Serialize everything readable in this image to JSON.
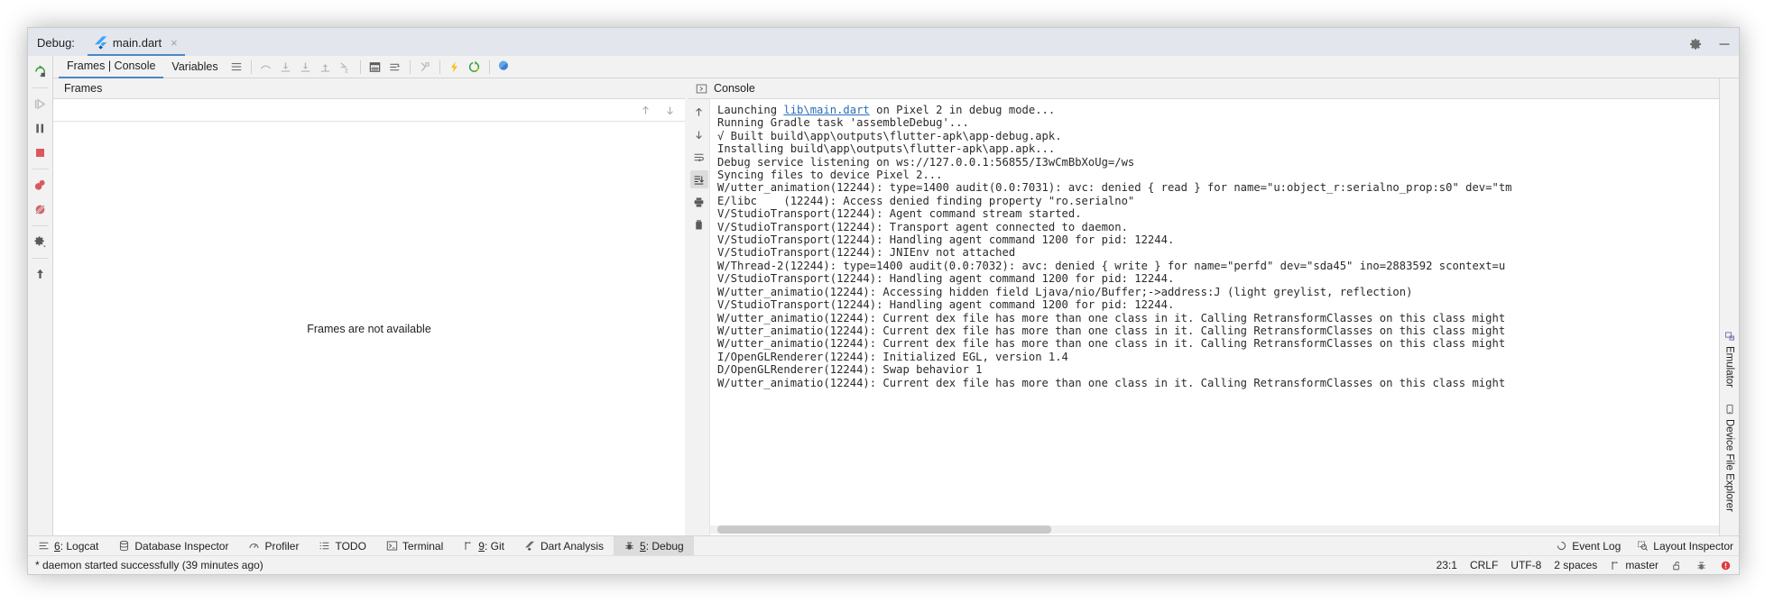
{
  "window": {
    "debug_label": "Debug:",
    "tab_title": "main.dart",
    "tab_close": "×",
    "settings_icon": "gear-icon",
    "minimize_icon": "minimize-icon"
  },
  "debug_toolbar": {
    "tabs": [
      {
        "label": "Frames | Console",
        "active": true
      },
      {
        "label": "Variables",
        "active": false
      }
    ],
    "icons": [
      "rerun-icon",
      "layout-icon",
      "step-over-icon",
      "step-into-icon",
      "force-step-into-icon",
      "step-out-icon",
      "run-to-cursor-icon",
      "evaluate-expression-icon",
      "watches-icon",
      "threads-icon",
      "hot-reload-icon",
      "hot-restart-icon",
      "open-devtools-icon"
    ],
    "layout_menu_icon": "layout-settings-icon"
  },
  "rail": {
    "buttons": [
      "rerun-icon",
      "resume-program-icon",
      "pause-program-icon",
      "stop-icon",
      "view-breakpoints-icon",
      "mute-breakpoints-icon",
      "settings-icon",
      "pin-tab-icon"
    ]
  },
  "frames": {
    "header": "Frames",
    "empty_message": "Frames are not available",
    "up_icon": "arrow-up-icon",
    "down_icon": "arrow-down-icon"
  },
  "console": {
    "header": "Console",
    "expand_icon": "expand-right-icon",
    "rail_buttons": [
      "scroll-up-icon",
      "scroll-down-icon",
      "soft-wrap-icon",
      "scroll-to-end-icon",
      "print-icon",
      "clear-all-icon"
    ],
    "lines": [
      {
        "pre": "Launching ",
        "link": "lib\\main.dart",
        "post": " on Pixel 2 in debug mode..."
      },
      {
        "text": "Running Gradle task 'assembleDebug'..."
      },
      {
        "text": "√ Built build\\app\\outputs\\flutter-apk\\app-debug.apk."
      },
      {
        "text": "Installing build\\app\\outputs\\flutter-apk\\app.apk..."
      },
      {
        "text": "Debug service listening on ws://127.0.0.1:56855/I3wCmBbXoUg=/ws"
      },
      {
        "text": "Syncing files to device Pixel 2..."
      },
      {
        "text": "W/utter_animation(12244): type=1400 audit(0.0:7031): avc: denied { read } for name=\"u:object_r:serialno_prop:s0\" dev=\"tm"
      },
      {
        "text": "E/libc    (12244): Access denied finding property \"ro.serialno\""
      },
      {
        "text": "V/StudioTransport(12244): Agent command stream started."
      },
      {
        "text": "V/StudioTransport(12244): Transport agent connected to daemon."
      },
      {
        "text": "V/StudioTransport(12244): Handling agent command 1200 for pid: 12244."
      },
      {
        "text": "V/StudioTransport(12244): JNIEnv not attached"
      },
      {
        "text": "W/Thread-2(12244): type=1400 audit(0.0:7032): avc: denied { write } for name=\"perfd\" dev=\"sda45\" ino=2883592 scontext=u"
      },
      {
        "text": "V/StudioTransport(12244): Handling agent command 1200 for pid: 12244."
      },
      {
        "text": "W/utter_animatio(12244): Accessing hidden field Ljava/nio/Buffer;->address:J (light greylist, reflection)"
      },
      {
        "text": "V/StudioTransport(12244): Handling agent command 1200 for pid: 12244."
      },
      {
        "text": "W/utter_animatio(12244): Current dex file has more than one class in it. Calling RetransformClasses on this class might"
      },
      {
        "text": "W/utter_animatio(12244): Current dex file has more than one class in it. Calling RetransformClasses on this class might"
      },
      {
        "text": "W/utter_animatio(12244): Current dex file has more than one class in it. Calling RetransformClasses on this class might"
      },
      {
        "text": "I/OpenGLRenderer(12244): Initialized EGL, version 1.4"
      },
      {
        "text": "D/OpenGLRenderer(12244): Swap behavior 1"
      },
      {
        "text": "W/utter_animatio(12244): Current dex file has more than one class in it. Calling RetransformClasses on this class might"
      }
    ]
  },
  "edge_strip": {
    "buttons": [
      {
        "label": "Emulator",
        "icon": "emulator-icon"
      },
      {
        "label": "Device File Explorer",
        "icon": "device-file-explorer-icon"
      }
    ]
  },
  "bottom_toolbar": {
    "items": [
      {
        "num": "6",
        "sep": ": ",
        "label": "Logcat",
        "icon": "logcat-icon",
        "active": false
      },
      {
        "num": "",
        "sep": "",
        "label": "Database Inspector",
        "icon": "database-icon",
        "active": false
      },
      {
        "num": "",
        "sep": "",
        "label": "Profiler",
        "icon": "profiler-icon",
        "active": false
      },
      {
        "num": "",
        "sep": "",
        "label": "TODO",
        "icon": "todo-icon",
        "active": false
      },
      {
        "num": "",
        "sep": "",
        "label": "Terminal",
        "icon": "terminal-icon",
        "active": false
      },
      {
        "num": "9",
        "sep": ": ",
        "label": "Git",
        "icon": "git-icon",
        "active": false
      },
      {
        "num": "",
        "sep": "",
        "label": "Dart Analysis",
        "icon": "dart-icon",
        "active": false
      },
      {
        "num": "5",
        "sep": ": ",
        "label": "Debug",
        "icon": "debug-bug-icon",
        "active": true
      }
    ],
    "right": [
      {
        "label": "Event Log",
        "icon": "event-log-icon"
      },
      {
        "label": "Layout Inspector",
        "icon": "layout-inspector-icon"
      }
    ]
  },
  "statusbar": {
    "message": "* daemon started successfully (39 minutes ago)",
    "caret": "23:1",
    "line_sep": "CRLF",
    "encoding": "UTF-8",
    "indent": "2 spaces",
    "branch": "master",
    "branch_icon": "vcs-branch-icon",
    "lock_icon": "unlocked-icon",
    "inspector_icon": "inspections-icon",
    "error_icon": "error-badge-icon"
  },
  "colors": {
    "accent_blue": "#4a88c7",
    "flutter_blue": "#42a5f5",
    "green": "#3b9e3b",
    "red": "#db5860",
    "yellow": "#f5c518",
    "toolbar_bg": "#f2f2f2",
    "title_bg": "#e3e7ed"
  }
}
